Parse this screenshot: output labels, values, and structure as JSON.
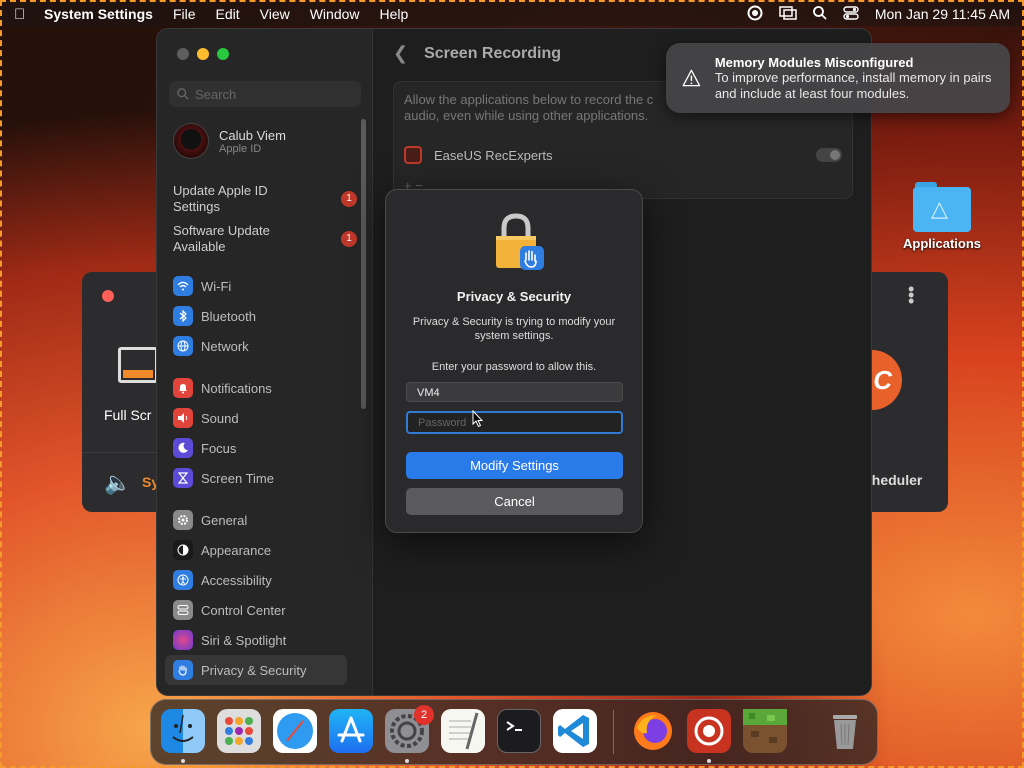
{
  "menubar": {
    "app_name": "System Settings",
    "menus": [
      "File",
      "Edit",
      "View",
      "Window",
      "Help"
    ],
    "datetime": "Mon Jan 29  11:45 AM"
  },
  "desktop": {
    "folder_label": "Applications"
  },
  "bg_window_left": {
    "full_label": "Full Scr",
    "sys_label": "Sy"
  },
  "bg_window_right": {
    "logo_letter": "C",
    "scheduler_label": "cheduler"
  },
  "sidebar": {
    "search_placeholder": "Search",
    "profile": {
      "name": "Calub Viem",
      "subtitle": "Apple ID"
    },
    "updates": [
      {
        "label": "Update Apple ID Settings",
        "badge": "1"
      },
      {
        "label": "Software Update Available",
        "badge": "1"
      }
    ],
    "group1": [
      {
        "label": "Wi-Fi",
        "icon": "wifi-icon",
        "color": "#2f7de1"
      },
      {
        "label": "Bluetooth",
        "icon": "bluetooth-icon",
        "color": "#2f7de1"
      },
      {
        "label": "Network",
        "icon": "globe-icon",
        "color": "#2f7de1"
      }
    ],
    "group2": [
      {
        "label": "Notifications",
        "icon": "bell-icon",
        "color": "#e0443a"
      },
      {
        "label": "Sound",
        "icon": "speaker-icon",
        "color": "#e0443a"
      },
      {
        "label": "Focus",
        "icon": "moon-icon",
        "color": "#5b4bd6"
      },
      {
        "label": "Screen Time",
        "icon": "hourglass-icon",
        "color": "#5b4bd6"
      }
    ],
    "group3": [
      {
        "label": "General",
        "icon": "gear-icon",
        "color": "#8a8a8a"
      },
      {
        "label": "Appearance",
        "icon": "appearance-icon",
        "color": "#1a1a1a"
      },
      {
        "label": "Accessibility",
        "icon": "accessibility-icon",
        "color": "#2f7de1"
      },
      {
        "label": "Control Center",
        "icon": "control-center-icon",
        "color": "#8a8a8a"
      },
      {
        "label": "Siri & Spotlight",
        "icon": "siri-icon",
        "color": "#b04bd0"
      },
      {
        "label": "Privacy & Security",
        "icon": "hand-icon",
        "color": "#2f7de1"
      }
    ]
  },
  "content": {
    "title": "Screen Recording",
    "description": "Allow the applications below to record the c audio, even while using other applications.",
    "app_name": "EaseUS RecExperts",
    "plusminus": "+  −"
  },
  "notification": {
    "title": "Memory Modules Misconfigured",
    "body": "To improve performance, install memory in pairs and include at least four modules."
  },
  "dialog": {
    "title": "Privacy & Security",
    "message": "Privacy & Security is trying to modify your system settings.",
    "prompt": "Enter your password to allow this.",
    "username": "VM4",
    "password_placeholder": "Password",
    "primary_button": "Modify Settings",
    "cancel_button": "Cancel"
  },
  "dock": {
    "apps": [
      "Finder",
      "Launchpad",
      "Safari",
      "App Store",
      "System Settings",
      "TextEdit",
      "Terminal",
      "Visual Studio Code",
      "Firefox",
      "EaseUS RecExperts",
      "Minecraft",
      "Trash"
    ],
    "settings_badge": "2"
  }
}
